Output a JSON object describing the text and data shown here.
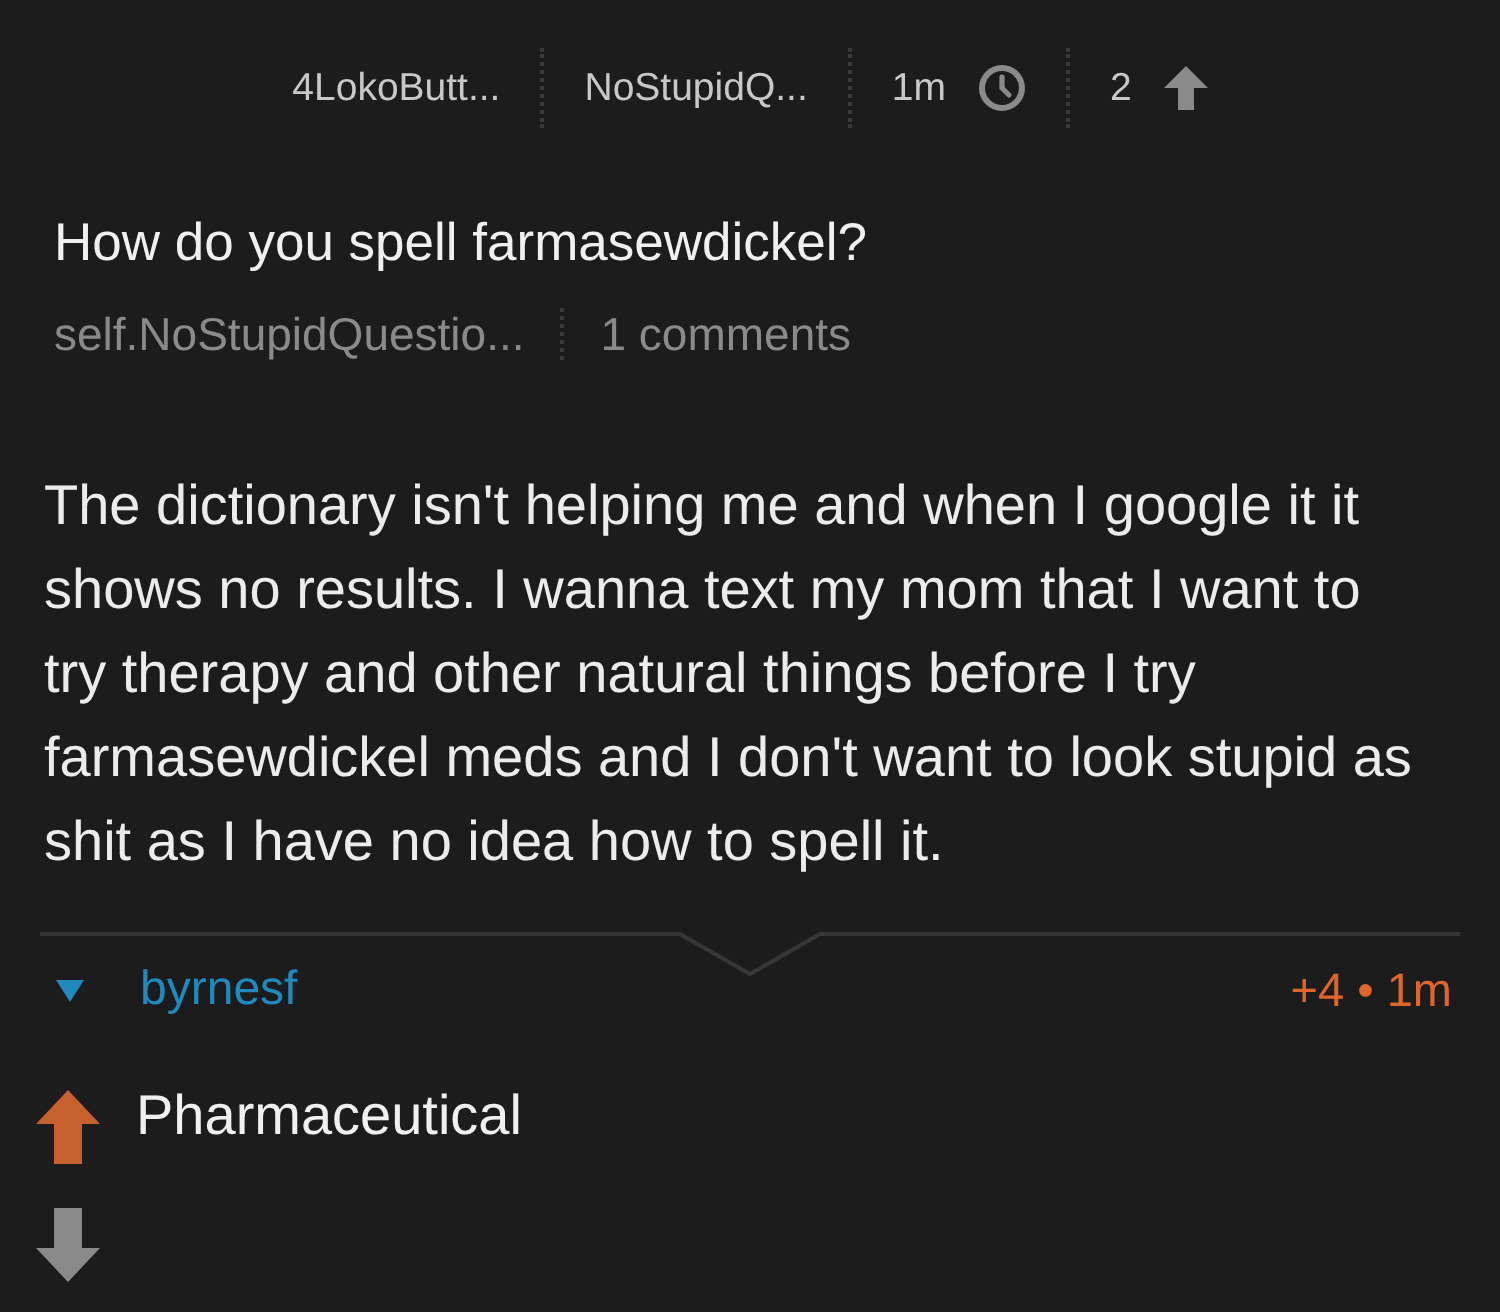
{
  "post_meta": {
    "author": "4LokoButt...",
    "subreddit": "NoStupidQ...",
    "age": "1m",
    "score": "2"
  },
  "post": {
    "title": "How do you spell farmasewdickel?",
    "domain": "self.NoStupidQuestio...",
    "comments": "1 comments",
    "body": "The dictionary isn't helping me and when I google it it shows no results. I wanna text my mom that I want to try therapy and other natural things before I try farmasewdickel meds and I don't want to look stupid as shit as I have no idea how to spell it."
  },
  "comments": [
    {
      "author": "byrnesf",
      "expanded": true,
      "meta": "+4 • 1m",
      "body": "Pharmaceutical",
      "upvoted": true,
      "downvoted": false
    }
  ]
}
